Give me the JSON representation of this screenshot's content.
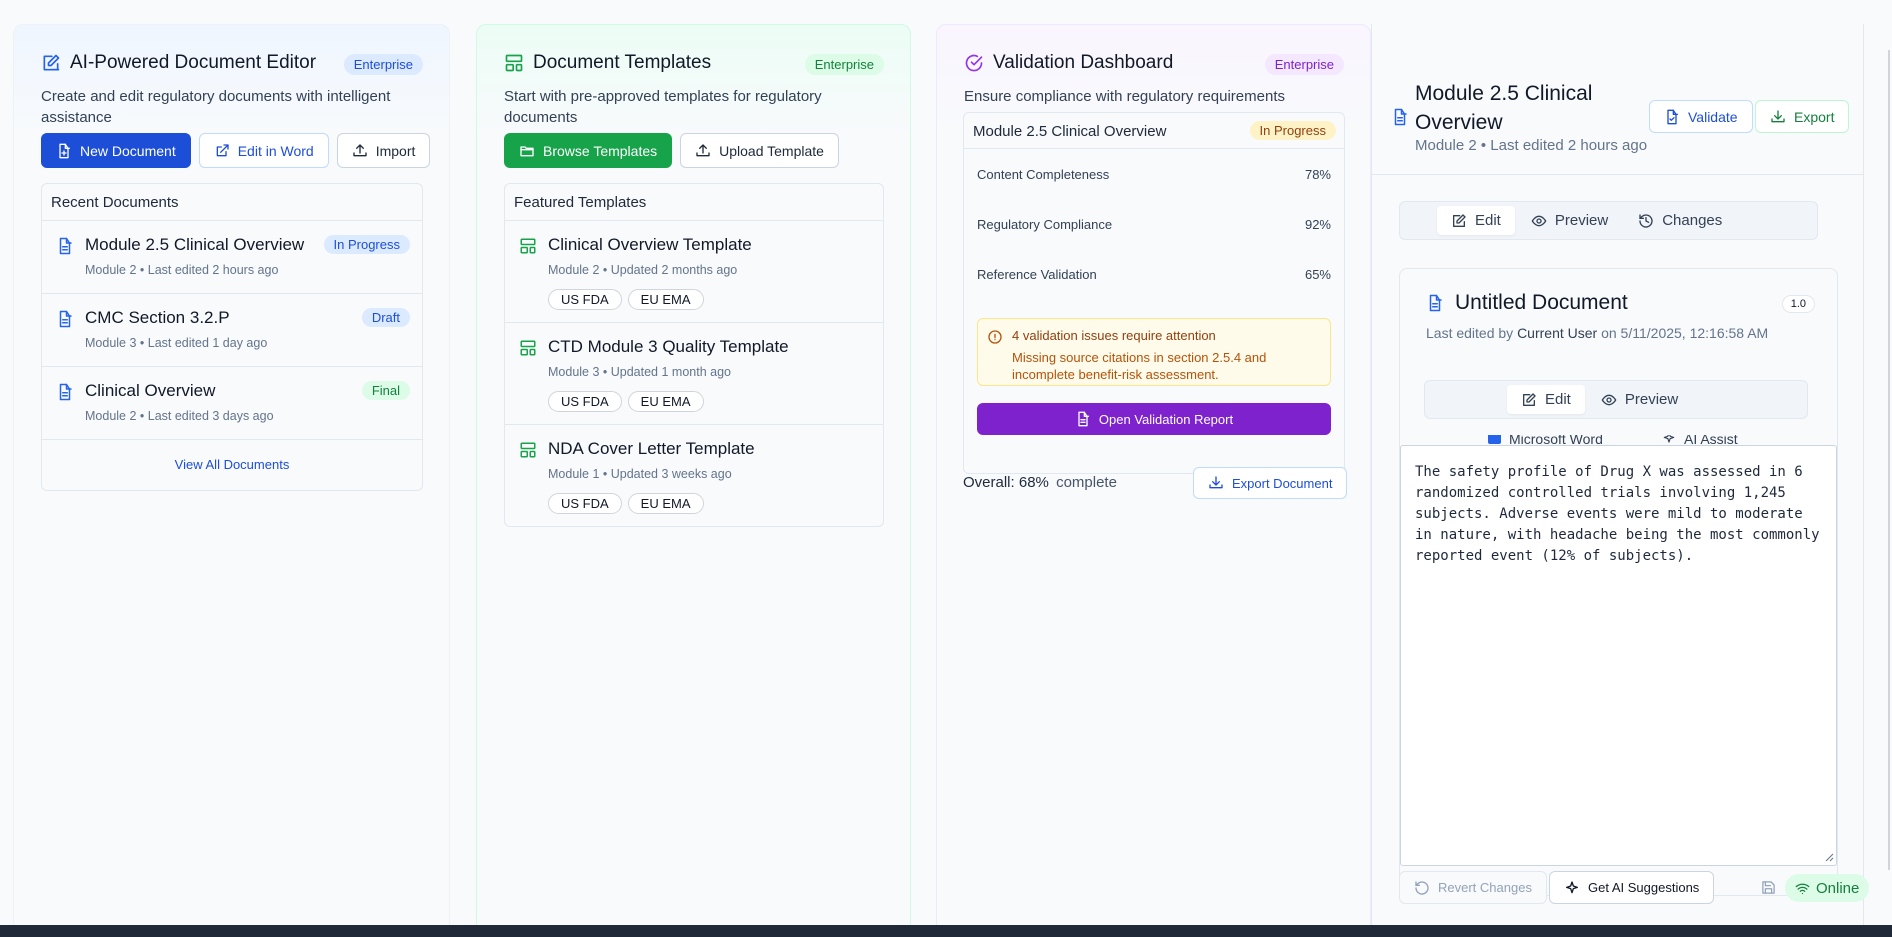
{
  "editor": {
    "title": "AI-Powered Document Editor",
    "badge": "Enterprise",
    "description": "Create and edit regulatory documents with intelligent assistance",
    "buttons": {
      "new": "New Document",
      "word": "Edit in Word",
      "import": "Import"
    },
    "recent_title": "Recent Documents",
    "recent": [
      {
        "title": "Module 2.5 Clinical Overview",
        "sub": "Module 2 • Last edited 2 hours ago",
        "status": "In Progress"
      },
      {
        "title": "CMC Section 3.2.P",
        "sub": "Module 3 • Last edited 1 day ago",
        "status": "Draft"
      },
      {
        "title": "Clinical Overview",
        "sub": "Module 2 • Last edited 3 days ago",
        "status": "Final"
      }
    ],
    "view_all": "View All Documents"
  },
  "templates": {
    "title": "Document Templates",
    "badge": "Enterprise",
    "description": "Start with pre-approved templates for regulatory documents",
    "buttons": {
      "browse": "Browse Templates",
      "upload": "Upload Template"
    },
    "featured_title": "Featured Templates",
    "items": [
      {
        "title": "Clinical Overview Template",
        "sub": "Module 2 • Updated 2 months ago",
        "tags": [
          "US FDA",
          "EU EMA"
        ]
      },
      {
        "title": "CTD Module 3 Quality Template",
        "sub": "Module 3 • Updated 1 month ago",
        "tags": [
          "US FDA",
          "EU EMA"
        ]
      },
      {
        "title": "NDA Cover Letter Template",
        "sub": "Module 1 • Updated 3 weeks ago",
        "tags": [
          "US FDA",
          "EU EMA"
        ]
      }
    ]
  },
  "validation": {
    "title": "Validation Dashboard",
    "badge": "Enterprise",
    "description": "Ensure compliance with regulatory requirements",
    "doc_title": "Module 2.5 Clinical Overview",
    "doc_status": "In Progress",
    "metrics": [
      {
        "label": "Content Completeness",
        "value": "78%"
      },
      {
        "label": "Regulatory Compliance",
        "value": "92%"
      },
      {
        "label": "Reference Validation",
        "value": "65%"
      }
    ],
    "alert_title": "4 validation issues require attention",
    "alert_body": "Missing source citations in section 2.5.4 and incomplete benefit-risk assessment.",
    "open_report": "Open Validation Report",
    "overall_label": "Overall:",
    "overall_value": "68%",
    "overall_suffix": "complete",
    "export_doc": "Export Document"
  },
  "doc_panel": {
    "title": "Module 2.5 Clinical Overview",
    "subtitle": "Module 2 • Last edited 2 hours ago",
    "validate": "Validate",
    "export": "Export",
    "tabs": [
      "Edit",
      "Preview",
      "Changes"
    ],
    "inner": {
      "title": "Untitled Document",
      "version": "1.0",
      "edited_prefix": "Last edited by",
      "edited_user": "Current User",
      "edited_on": "on 5/11/2025, 12:16:58 AM",
      "tabs": [
        "Edit",
        "Preview"
      ],
      "subtabs": [
        "Microsoft Word",
        "AI Assist"
      ],
      "body": "The safety profile of Drug X was assessed in 6 randomized controlled trials involving 1,245 subjects. Adverse events were mild to moderate in nature, with headache being the most commonly reported event (12% of subjects)."
    },
    "revert": "Revert Changes",
    "ai_suggest": "Get AI Suggestions",
    "online": "Online"
  },
  "colors": {
    "blue": "#1d4ed8",
    "green": "#16a34a",
    "purple": "#7e22ce",
    "amber": "#b45309"
  }
}
